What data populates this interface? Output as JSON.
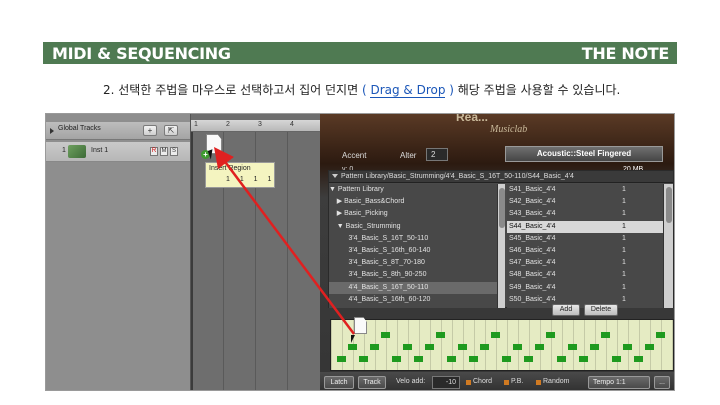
{
  "header": {
    "left_title": "MIDI & SEQUENCING",
    "right_title": "THE NOTE"
  },
  "instruction": {
    "prefix": "2. 선택한 주법을 마우스로 선택하고서 집어 던지면 ",
    "paren_open": "( ",
    "link": "Drag & Drop",
    "paren_close": " )",
    "suffix": " 해당 주법을 사용할 수 있습니다."
  },
  "tracks": {
    "header_label": "Global Tracks",
    "add_label": "+",
    "options_label": "⇱",
    "track_number": "1",
    "track_name": "Inst 1",
    "rec_label": "R",
    "mute_label": "M",
    "solo_label": "S"
  },
  "ruler": {
    "marks": [
      "1",
      "2",
      "3",
      "4"
    ]
  },
  "tooltip": {
    "title": "Insert Region",
    "values": "1 1 1 1"
  },
  "plugin": {
    "brand": "Rea...",
    "brand_sub": "Musiclab",
    "accent_label": "Accent",
    "alter_label": "Alter",
    "alter_value": "2",
    "v_label": "v: 0",
    "preset": "Acoustic::Steel Fingered",
    "size": "20 MB",
    "path": "Pattern Library/Basic_Strumming/4'4_Basic_S_16T_50-110/S44_Basic_4'4",
    "tree_items": [
      "▼ Pattern Library",
      "    ▶ Basic_Bass&Chord",
      "    ▶ Basic_Picking",
      "    ▼ Basic_Strumming",
      "          3'4_Basic_S_16T_50-110",
      "          3'4_Basic_S_16th_60-140",
      "          3'4_Basic_S_8T_70-180",
      "          3'4_Basic_S_8th_90-250",
      "          4'4_Basic_S_16T_50-110",
      "          4'4_Basic_S_16th_60-120"
    ],
    "tree_selected": 8,
    "list_items": [
      {
        "name": "S41_Basic_4'4",
        "count": "1"
      },
      {
        "name": "S42_Basic_4'4",
        "count": "1"
      },
      {
        "name": "S43_Basic_4'4",
        "count": "1"
      },
      {
        "name": "S44_Basic_4'4",
        "count": "1"
      },
      {
        "name": "S45_Basic_4'4",
        "count": "1"
      },
      {
        "name": "S46_Basic_4'4",
        "count": "1"
      },
      {
        "name": "S47_Basic_4'4",
        "count": "1"
      },
      {
        "name": "S48_Basic_4'4",
        "count": "1"
      },
      {
        "name": "S49_Basic_4'4",
        "count": "1"
      },
      {
        "name": "S50_Basic_4'4",
        "count": "1"
      }
    ],
    "list_selected": 3,
    "add_button": "Add",
    "delete_button": "Delete",
    "bottom": {
      "latch": "Latch",
      "track": "Track",
      "velo_label": "Velo add:",
      "velo_value": "-10",
      "chord": "Chord",
      "pb": "P.B.",
      "random": "Random",
      "tempo": "Tempo 1:1",
      "more": "..."
    }
  },
  "colors": {
    "header_bg": "#4f7a52",
    "link": "#1a56b8",
    "note": "#1f9a1f",
    "arrow": "#e02020",
    "grid_bg": "#e5ebc3"
  }
}
